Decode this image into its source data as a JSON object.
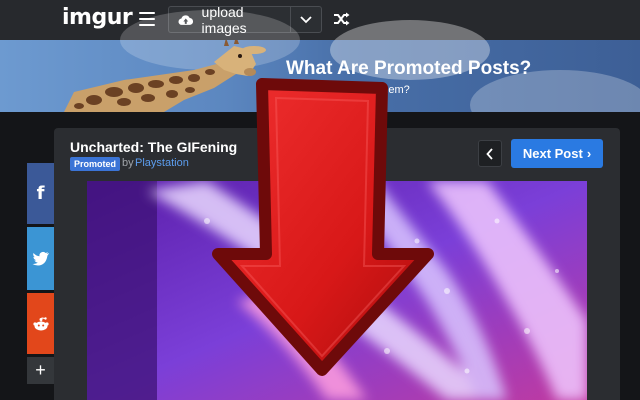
{
  "topbar": {
    "logo": "imgur",
    "upload_label": "upload images",
    "icons": [
      "hamburger-menu-icon",
      "cloud-upload-icon",
      "chevron-down-icon",
      "shuffle-icon"
    ]
  },
  "banner": {
    "title": "What Are Promoted Posts?",
    "subtitle": "g them?"
  },
  "post": {
    "title": "Uncharted: The GIFening",
    "badge": "Promoted",
    "by": "by",
    "author": "Playstation",
    "prev_label": "‹",
    "next_label": "Next Post",
    "next_chevron": "›"
  },
  "share": {
    "facebook": "f",
    "more": "+"
  },
  "colors": {
    "accent": "#2a7ae2",
    "promoted_badge": "#3b74d6",
    "arrow_red": "#d61a1a"
  }
}
